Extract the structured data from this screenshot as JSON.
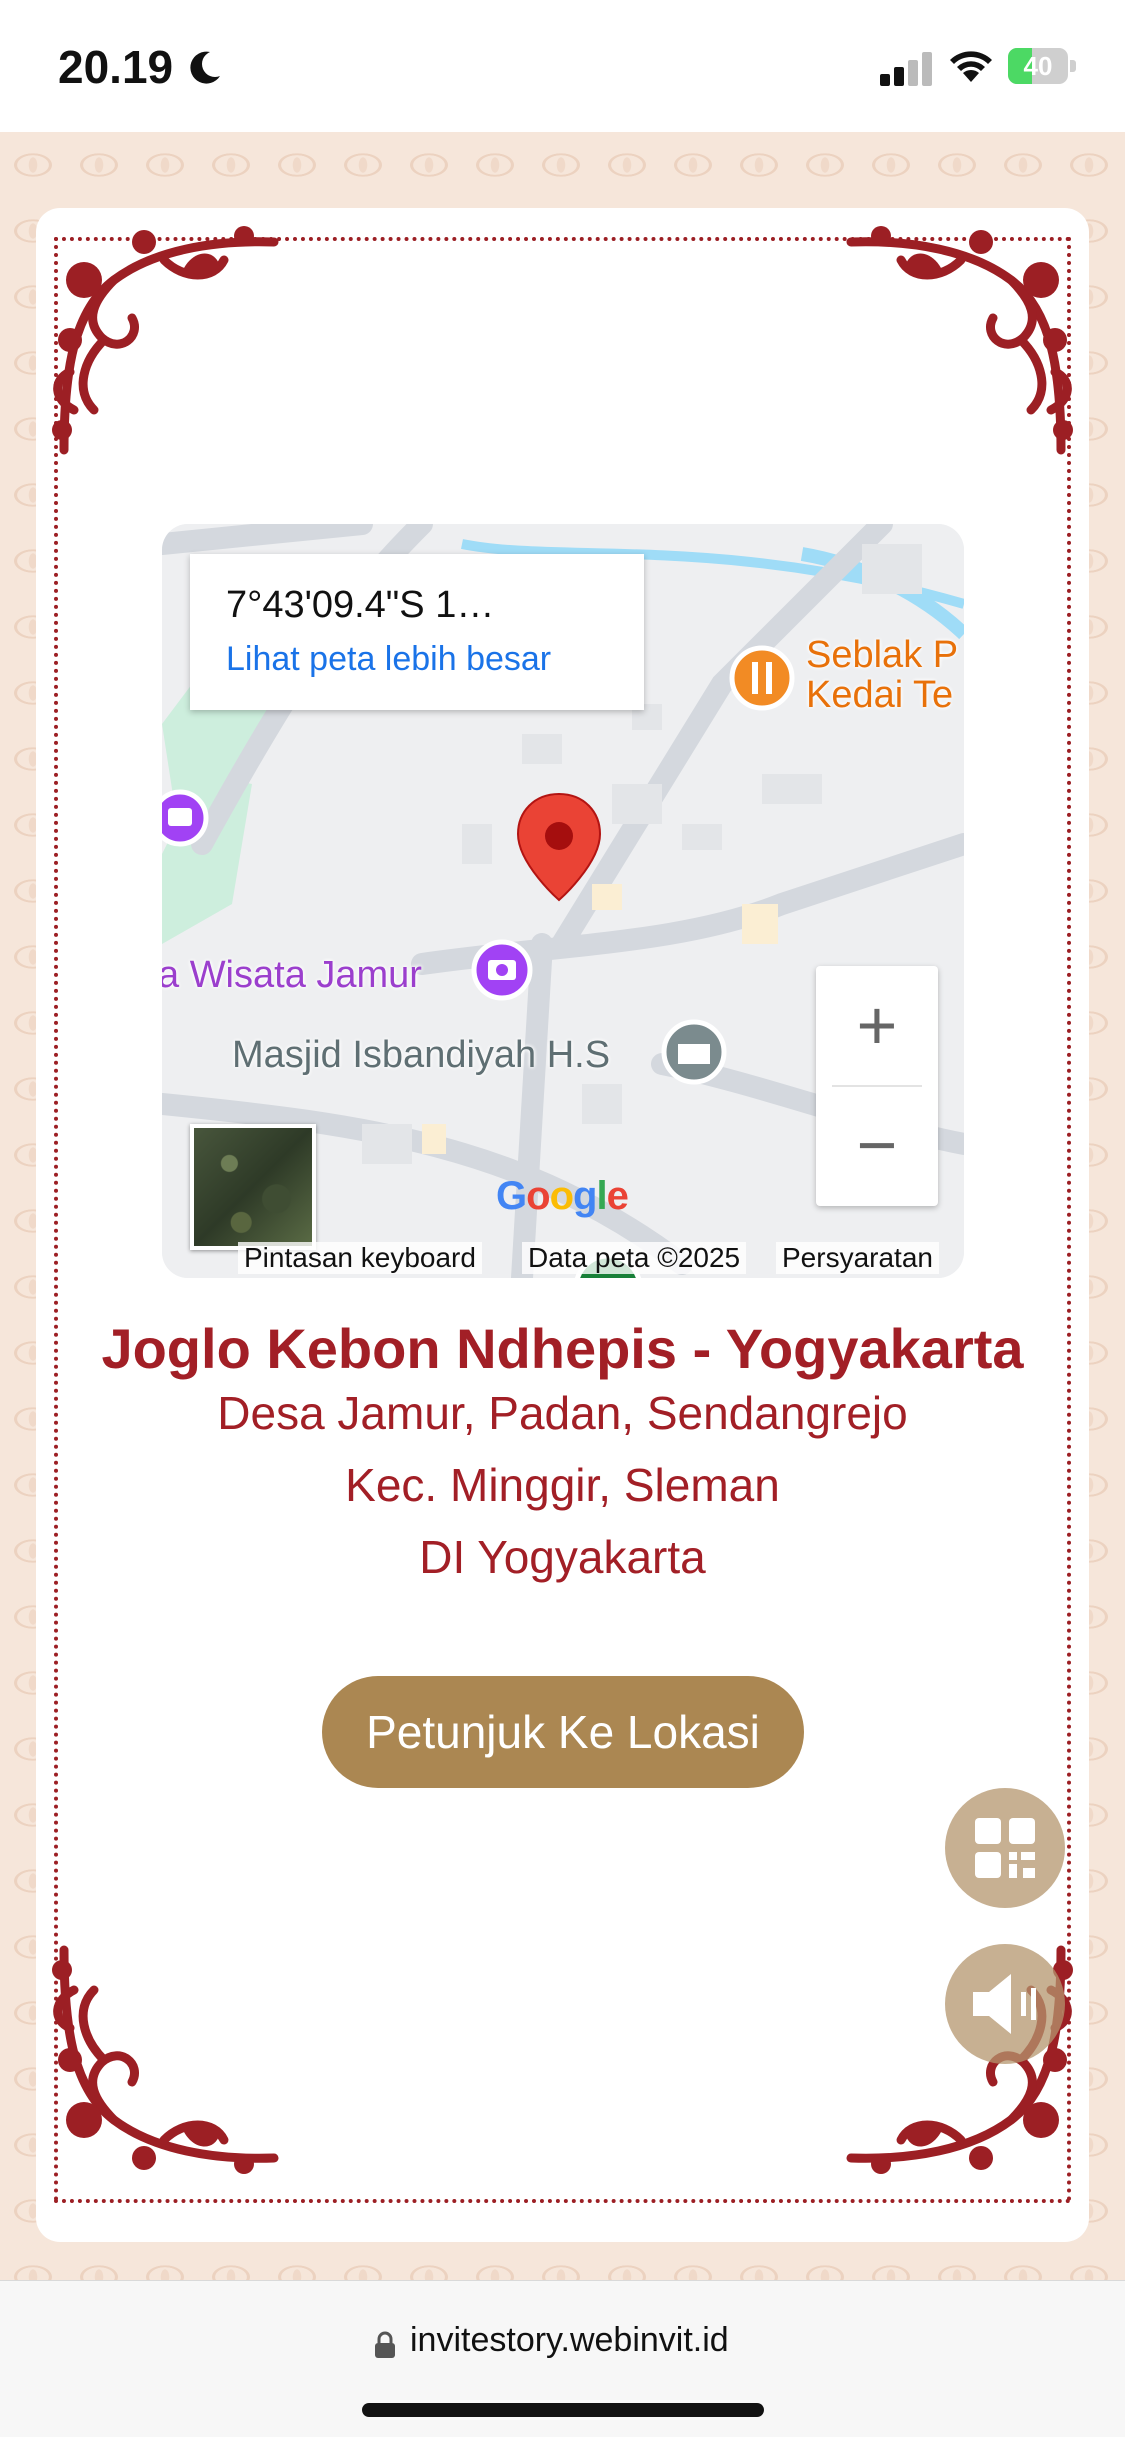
{
  "status_bar": {
    "time": "20.19",
    "battery_level": "40",
    "battery_fraction": 0.4,
    "icons": [
      "moon-icon",
      "signal-icon",
      "wifi-icon",
      "battery-icon"
    ]
  },
  "map": {
    "coords": "7°43'09.4\"S 1…",
    "bigger_map_link": "Lihat peta lebih besar",
    "zoom_in": "+",
    "zoom_out": "−",
    "google_logo": "Google",
    "keyboard_shortcuts": "Pintasan keyboard",
    "map_data": "Data peta ©2025",
    "terms": "Persyaratan",
    "places": {
      "wisata_jamur": "a Wisata Jamur",
      "masjid": "Masjid Isbandiyah H.S",
      "seblak_line1": "Seblak P",
      "seblak_line2": "Kedai Te"
    }
  },
  "venue": {
    "name": "Joglo Kebon Ndhepis - Yogyakarta",
    "address_line1": "Desa Jamur, Padan, Sendangrejo",
    "address_line2": "Kec. Minggir, Sleman",
    "address_line3": "DI Yogyakarta",
    "directions_button": "Petunjuk Ke Lokasi"
  },
  "browser": {
    "url": "invitestory.webinvit.id"
  },
  "colors": {
    "accent_red": "#a21f26",
    "button_gold": "#ab8752",
    "link_blue": "#1a73e8"
  }
}
